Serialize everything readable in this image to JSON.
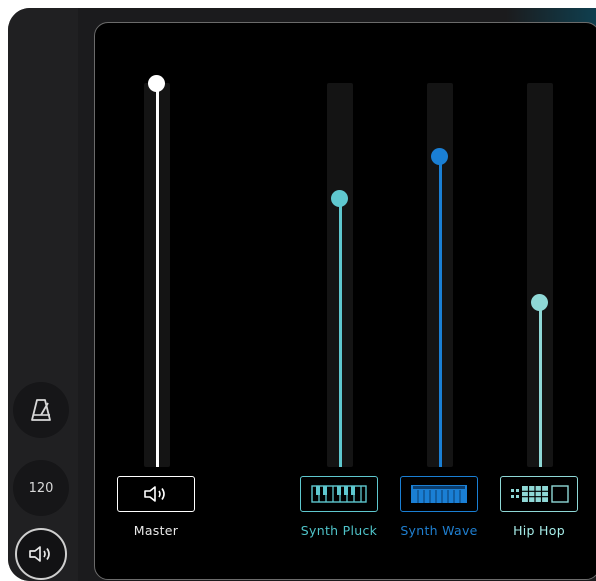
{
  "sidebar": {
    "tempo_value": "120"
  },
  "mixer": {
    "channels": [
      {
        "id": "master",
        "label": "Master",
        "level": 1.0,
        "color": "#ffffff",
        "label_color": "#e8e8e8",
        "icon": "speaker-icon"
      },
      {
        "id": "synth-pluck",
        "label": "Synth Pluck",
        "level": 0.7,
        "color": "#5fc8cf",
        "label_color": "#4fc3c9",
        "icon": "keyboard-icon"
      },
      {
        "id": "synth-wave",
        "label": "Synth Wave",
        "level": 0.81,
        "color": "#1a7fd4",
        "label_color": "#1f7fd0",
        "icon": "keyboard-icon"
      },
      {
        "id": "hip-hop",
        "label": "Hip Hop",
        "level": 0.43,
        "color": "#8fd8d6",
        "label_color": "#a6ece8",
        "icon": "drum-pads-icon"
      }
    ]
  }
}
